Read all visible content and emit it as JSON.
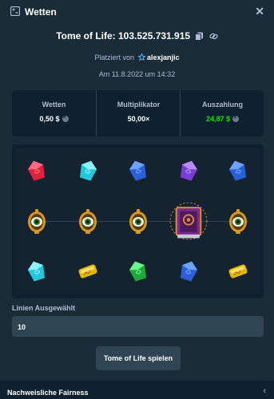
{
  "header": {
    "title": "Wetten",
    "close_label": "✕"
  },
  "bet": {
    "game_title": "Tome of Life: 103.525.731.915",
    "placed_prefix": "Platziert von",
    "username": "alexjanjic",
    "date": "Am 11.8.2022 um 14:32"
  },
  "stats": {
    "bet_label": "Wetten",
    "bet_value": "0,50 $",
    "multiplier_label": "Multiplikator",
    "multiplier_value": "50,00×",
    "payout_label": "Auszahlung",
    "payout_value": "24,87 $"
  },
  "reels": {
    "rows": [
      [
        "red-gem",
        "cyan-gem",
        "blue-gem",
        "purple-gem",
        "blue-gem"
      ],
      [
        "eye-amulet",
        "eye-amulet",
        "eye-amulet",
        "tome-book",
        "eye-amulet"
      ],
      [
        "cyan-gem",
        "gold-gem",
        "green-gem",
        "blue-gem",
        "gold-gem"
      ]
    ]
  },
  "lines": {
    "label": "Linien Ausgewählt",
    "value": "10"
  },
  "play_button": "Tome of Life spielen",
  "footer": {
    "title": "Nachweisliche Fairness",
    "chevron": "‹"
  },
  "colors": {
    "background": "#1a2c38",
    "panel": "#0f212e",
    "accent_green": "#00e701",
    "muted_text": "#b1bad3"
  }
}
